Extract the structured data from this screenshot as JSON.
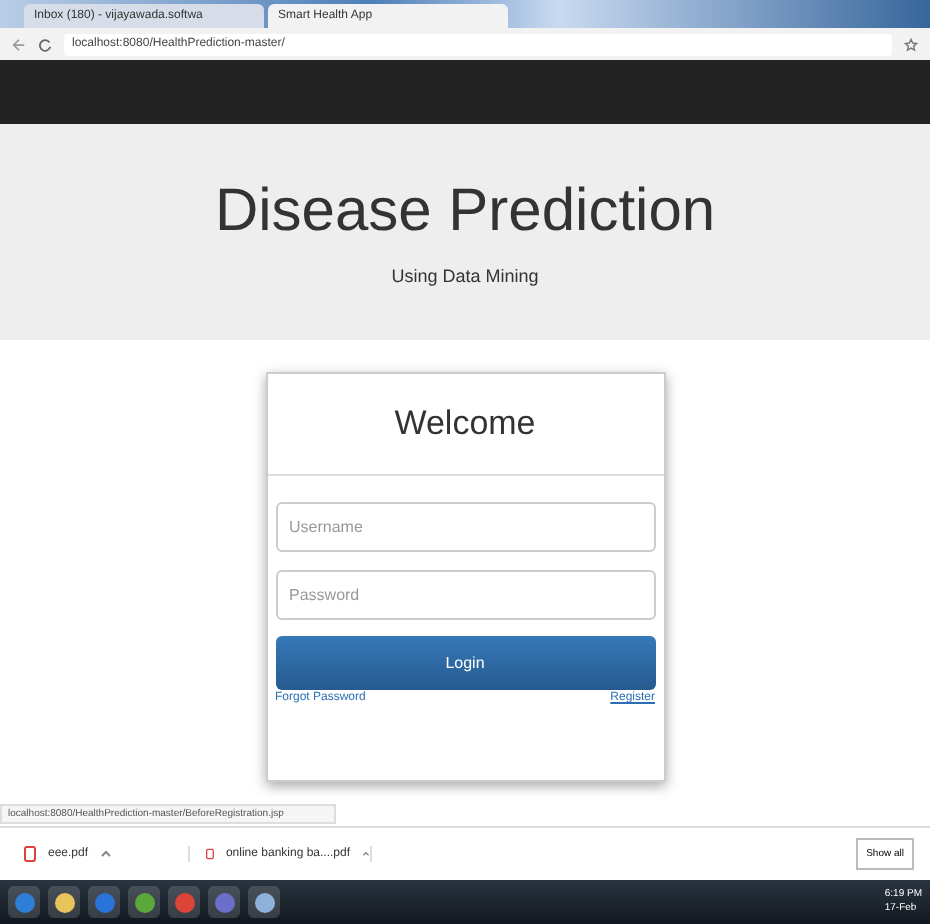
{
  "browser": {
    "tabs": [
      {
        "title": "Inbox (180) - vijayawada.softwa",
        "selected": false
      },
      {
        "title": "Smart Health App",
        "selected": true
      }
    ],
    "url": "localhost:8080/HealthPrediction-master/"
  },
  "header": {
    "title": "Disease Prediction",
    "subtitle": "Using Data Mining"
  },
  "login": {
    "heading": "Welcome",
    "fields": [
      {
        "placeholder": "Username"
      },
      {
        "placeholder": "Password"
      }
    ],
    "button": "Login",
    "links": [
      "Forgot Password",
      "Register"
    ]
  },
  "status_url": "localhost:8080/HealthPrediction-master/BeforeRegistration.jsp",
  "downloads": {
    "items": [
      "eee.pdf",
      "online banking ba....pdf"
    ],
    "show_all": "Show all"
  },
  "taskbar": {
    "apps": [
      {
        "color": "#2f7fd6"
      },
      {
        "color": "#e8c45a"
      },
      {
        "color": "#2a73d9"
      },
      {
        "color": "#5aa83a"
      },
      {
        "color": "#db4437"
      },
      {
        "color": "#6b6fc9"
      },
      {
        "color": "#8fb0d8"
      }
    ],
    "time": "6:19 PM",
    "date": "17-Feb"
  }
}
